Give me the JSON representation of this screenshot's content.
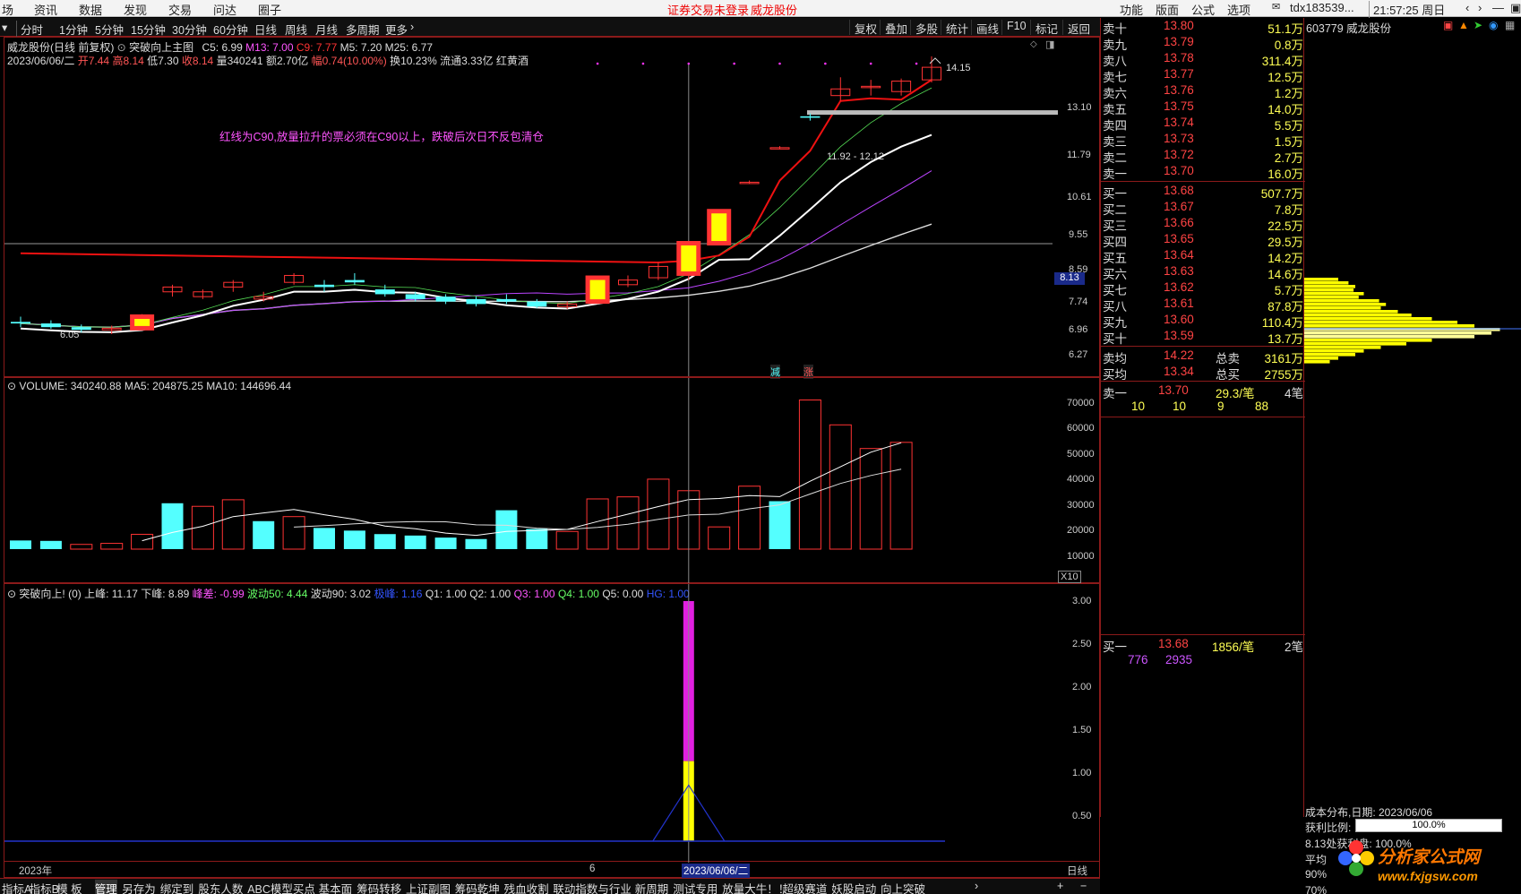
{
  "menu": {
    "items": [
      "场",
      "资讯",
      "数据",
      "发现",
      "交易",
      "问达",
      "圈子"
    ],
    "warning": "证券交易未登录",
    "stock": "威龙股份",
    "right_items": [
      "功能",
      "版面",
      "公式",
      "选项"
    ],
    "account": "tdx183539...",
    "clock": "21:57:25 周日"
  },
  "periods": [
    "分时",
    "1分钟",
    "5分钟",
    "15分钟",
    "30分钟",
    "60分钟",
    "日线",
    "周线",
    "月线",
    "多周期",
    "更多"
  ],
  "toolbar": [
    "复权",
    "叠加",
    "多股",
    "统计",
    "画线",
    "F10",
    "标记",
    "返回"
  ],
  "main": {
    "title": "威龙股份(日线 前复权)",
    "formula": "突破向上主图",
    "c5": "C5: 6.99",
    "m13": "M13: 7.00",
    "c9": "C9: 7.77",
    "m5": "M5: 7.20",
    "m25": "M25: 6.77",
    "date": "2023/06/06/二",
    "open": "开7.44",
    "high": "高8.14",
    "low": "低7.30",
    "close": "收8.14",
    "vol": "量340241",
    "amt": "额2.70亿",
    "chg": "幅0.74(10.00%)",
    "turn": "换10.23%",
    "float": "流通3.33亿",
    "concept": "红黄酒",
    "note": "红线为C90,放量拉升的票必须在C90以上，跌破后次日不反包清仓",
    "hi_label": "14.15",
    "lo_label": "6.05",
    "range_label": "11.92 - 12.12",
    "price_tag": "8.13",
    "down_tag": "减",
    "up_tag": "涨",
    "yticks": [
      "13.10",
      "11.79",
      "10.61",
      "9.55",
      "8.59",
      "7.74",
      "6.96",
      "6.27"
    ]
  },
  "volume": {
    "title": "VOLUME: 340240.88",
    "ma5": "MA5: 204875.25",
    "ma10": "MA10: 144696.44",
    "yticks": [
      "70000",
      "60000",
      "50000",
      "40000",
      "30000",
      "20000",
      "10000"
    ],
    "unit": "X10"
  },
  "ind": {
    "title": "突破向上!",
    "p0": "(0)",
    "up": "上峰: 11.17",
    "down": "下峰: 8.89",
    "diff": "峰差: -0.99",
    "b50": "波动50: 4.44",
    "b90": "波动90: 3.02",
    "jf": "极峰: 1.16",
    "q1": "Q1: 1.00",
    "q2": "Q2: 1.00",
    "q3": "Q3: 1.00",
    "q4": "Q4: 1.00",
    "q5": "Q5: 0.00",
    "hg": "HG: 1.00",
    "yticks": [
      "3.00",
      "2.50",
      "2.00",
      "1.50",
      "1.00",
      "0.50"
    ]
  },
  "xaxis": {
    "year": "2023年",
    "month": "6",
    "cursor": "2023/06/06/二",
    "period": "日线"
  },
  "book": {
    "sells": [
      [
        "卖十",
        "13.80",
        "51.1万"
      ],
      [
        "卖九",
        "13.79",
        "0.8万"
      ],
      [
        "卖八",
        "13.78",
        "311.4万"
      ],
      [
        "卖七",
        "13.77",
        "12.5万"
      ],
      [
        "卖六",
        "13.76",
        "1.2万"
      ],
      [
        "卖五",
        "13.75",
        "14.0万"
      ],
      [
        "卖四",
        "13.74",
        "5.5万"
      ],
      [
        "卖三",
        "13.73",
        "1.5万"
      ],
      [
        "卖二",
        "13.72",
        "2.7万"
      ],
      [
        "卖一",
        "13.70",
        "16.0万"
      ]
    ],
    "buys": [
      [
        "买一",
        "13.68",
        "507.7万"
      ],
      [
        "买二",
        "13.67",
        "7.8万"
      ],
      [
        "买三",
        "13.66",
        "22.5万"
      ],
      [
        "买四",
        "13.65",
        "29.5万"
      ],
      [
        "买五",
        "13.64",
        "14.2万"
      ],
      [
        "买六",
        "13.63",
        "14.6万"
      ],
      [
        "买七",
        "13.62",
        "5.7万"
      ],
      [
        "买八",
        "13.61",
        "87.8万"
      ],
      [
        "买九",
        "13.60",
        "110.4万"
      ],
      [
        "买十",
        "13.59",
        "13.7万"
      ]
    ],
    "avg_sell": [
      "卖均",
      "14.22",
      "总卖",
      "3161万"
    ],
    "avg_buy": [
      "买均",
      "13.34",
      "总买",
      "2755万"
    ],
    "sell1": [
      "卖一",
      "13.70",
      "29.3/笔",
      "4笔"
    ],
    "sell1_q": [
      "10",
      "10",
      "9",
      "88"
    ],
    "buy1": [
      "买一",
      "13.68",
      "1856/笔",
      "2笔"
    ],
    "buy1_q": [
      "776",
      "2935"
    ]
  },
  "right": {
    "code": "603779 威龙股份",
    "cost_title": "成本分布,日期: 2023/06/06",
    "profit_label": "获利比例:",
    "profit_val": "100.0%",
    "profit_at": "8.13处获利盘: 100.0%",
    "avg": "平均",
    "p90": "90%",
    "p70": "70%",
    "watermark": "分析家公式网",
    "site": "www.fxjgsw.com"
  },
  "tabs": [
    "指标A",
    "指标B",
    "模 板",
    "管理",
    "另存为",
    "绑定到",
    "股东人数",
    "ABC模型买点",
    "基本面",
    "筹码转移",
    "上证副图",
    "筹码乾坤",
    "残血收割",
    "联动指数与行业",
    "新周期",
    "测试专用",
    "放量大牛！！",
    "超级赛道",
    "妖股启动",
    "向上突破"
  ],
  "colors": {
    "up": "#ff3333",
    "down": "#54ffff",
    "red_line": "#ee1111",
    "yellow": "#ffff00",
    "magenta": "#ff33ff"
  },
  "chart_data": [
    {
      "type": "candlestick",
      "title": "威龙股份(日线 前复权)",
      "ylim": [
        6.05,
        14.15
      ],
      "ohlc": [
        [
          6.45,
          6.55,
          6.35,
          6.42
        ],
        [
          6.42,
          6.48,
          6.32,
          6.35
        ],
        [
          6.35,
          6.4,
          6.25,
          6.3
        ],
        [
          6.3,
          6.38,
          6.22,
          6.33
        ],
        [
          6.33,
          6.6,
          6.3,
          6.55
        ],
        [
          7.05,
          7.2,
          6.95,
          7.15
        ],
        [
          6.95,
          7.1,
          6.9,
          7.05
        ],
        [
          7.15,
          7.3,
          7.05,
          7.25
        ],
        [
          6.9,
          7.05,
          6.85,
          6.95
        ],
        [
          7.25,
          7.45,
          7.2,
          7.4
        ],
        [
          7.2,
          7.3,
          7.05,
          7.15
        ],
        [
          7.3,
          7.45,
          7.2,
          7.25
        ],
        [
          7.1,
          7.2,
          6.95,
          7.0
        ],
        [
          7.0,
          7.05,
          6.85,
          6.9
        ],
        [
          6.95,
          7.0,
          6.8,
          6.85
        ],
        [
          6.9,
          6.95,
          6.75,
          6.8
        ],
        [
          6.9,
          7.0,
          6.8,
          6.85
        ],
        [
          6.85,
          6.9,
          6.72,
          6.75
        ],
        [
          6.75,
          6.85,
          6.7,
          6.8
        ],
        [
          6.85,
          7.35,
          6.8,
          7.35
        ],
        [
          7.2,
          7.4,
          7.15,
          7.3
        ],
        [
          7.35,
          7.7,
          7.3,
          7.6
        ],
        [
          7.44,
          8.14,
          7.3,
          8.14
        ],
        [
          8.14,
          8.95,
          8.1,
          8.95
        ],
        [
          9.75,
          9.8,
          9.7,
          9.75
        ],
        [
          10.8,
          10.85,
          10.75,
          10.8
        ],
        [
          11.85,
          11.95,
          11.7,
          11.8
        ],
        [
          12.6,
          13.3,
          12.4,
          12.85
        ],
        [
          12.9,
          13.2,
          12.6,
          12.95
        ],
        [
          12.75,
          13.25,
          12.6,
          13.15
        ],
        [
          13.2,
          14.15,
          13.1,
          13.7
        ]
      ],
      "c90": [
        7.9,
        7.89,
        7.88,
        7.87,
        7.86,
        7.85,
        7.84,
        7.83,
        7.82,
        7.81,
        7.8,
        7.79,
        7.78,
        7.77,
        7.76,
        7.75,
        7.74,
        7.73,
        7.72,
        7.71,
        7.7,
        7.69,
        7.73,
        7.85,
        8.3,
        9.8,
        10.7,
        12.4,
        12.5,
        12.45,
        13.2
      ]
    },
    {
      "type": "bar",
      "title": "VOLUME",
      "ylim": [
        0,
        75000
      ],
      "values": [
        4200,
        4000,
        2300,
        2800,
        7200,
        22300,
        20800,
        24000,
        13600,
        15800,
        10300,
        9000,
        7300,
        6600,
        5600,
        4900,
        18900,
        9800,
        8600,
        24400,
        25400,
        34000,
        28400,
        10800,
        30600,
        23300,
        72500,
        60400,
        48900,
        51900
      ],
      "ma5": [
        null,
        null,
        null,
        null,
        4100,
        8100,
        11100,
        15800,
        17600,
        19300,
        16700,
        14500,
        11200,
        9900,
        7800,
        6700,
        8600,
        9100,
        9600,
        13400,
        17000,
        20700,
        24100,
        24600,
        26000,
        25500,
        33000,
        40000,
        47100,
        51700
      ],
      "ma10": [
        null,
        null,
        null,
        null,
        null,
        null,
        null,
        null,
        null,
        10700,
        11400,
        12300,
        13000,
        13400,
        13300,
        11800,
        11600,
        10200,
        9600,
        10600,
        12100,
        14500,
        16600,
        17000,
        19600,
        21500,
        26800,
        31900,
        35800,
        38900
      ]
    },
    {
      "type": "bar",
      "title": "突破向上!",
      "ylim": [
        0,
        3.0
      ],
      "index": 22,
      "magenta": 3.0,
      "yellow": 1.0
    }
  ]
}
